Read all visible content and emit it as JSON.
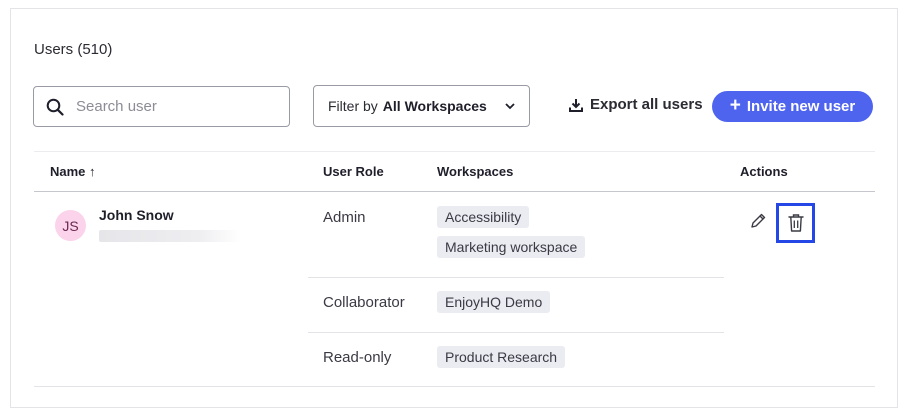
{
  "header": {
    "title": "Users (510)"
  },
  "search": {
    "placeholder": "Search user",
    "icon": "search-icon"
  },
  "filter": {
    "prefix": "Filter by",
    "value": "All Workspaces",
    "icon": "chevron-down-icon"
  },
  "export": {
    "label": "Export all users",
    "icon": "download-icon"
  },
  "invite": {
    "label": "Invite new user",
    "icon": "plus-icon",
    "color": "#4e64ef"
  },
  "table": {
    "columns": {
      "name": "Name ↑",
      "role": "User Role",
      "workspaces": "Workspaces",
      "actions": "Actions"
    },
    "user": {
      "initials": "JS",
      "name": "John Snow",
      "memberships": [
        {
          "role": "Admin",
          "workspaces": [
            "Accessibility",
            "Marketing workspace"
          ]
        },
        {
          "role": "Collaborator",
          "workspaces": [
            "EnjoyHQ Demo"
          ]
        },
        {
          "role": "Read-only",
          "workspaces": [
            "Product Research"
          ]
        }
      ],
      "actions": {
        "edit_icon": "pencil-icon",
        "delete_icon": "trash-icon"
      }
    }
  },
  "colors": {
    "accent": "#4e64ef",
    "highlight": "#2447e6",
    "avatar_bg": "#fbd3ea",
    "tag_bg": "#ebebf2"
  }
}
